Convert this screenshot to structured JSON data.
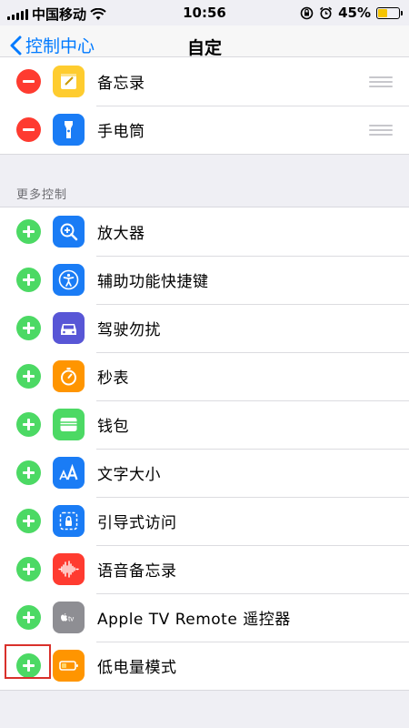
{
  "status_bar": {
    "carrier": "中国移动",
    "time": "10:56",
    "battery_percent": "45%",
    "battery_level": 0.45
  },
  "nav": {
    "back_label": "控制中心",
    "title": "自定"
  },
  "included_controls": [
    {
      "label": "备忘录",
      "icon": "notes-icon"
    },
    {
      "label": "手电筒",
      "icon": "flashlight-icon"
    }
  ],
  "more_controls_header": "更多控制",
  "more_controls": [
    {
      "label": "放大器",
      "icon": "magnifier-icon"
    },
    {
      "label": "辅助功能快捷键",
      "icon": "accessibility-icon"
    },
    {
      "label": "驾驶勿扰",
      "icon": "car-icon"
    },
    {
      "label": "秒表",
      "icon": "stopwatch-icon"
    },
    {
      "label": "钱包",
      "icon": "wallet-icon"
    },
    {
      "label": "文字大小",
      "icon": "text-size-icon"
    },
    {
      "label": "引导式访问",
      "icon": "guided-access-icon"
    },
    {
      "label": "语音备忘录",
      "icon": "voice-memo-icon"
    },
    {
      "label": "Apple TV Remote 遥控器",
      "icon": "apple-tv-remote-icon",
      "icon_text": "tv"
    },
    {
      "label": "低电量模式",
      "icon": "low-power-mode-icon"
    }
  ],
  "colors": {
    "remove": "#fe3b30",
    "add": "#4cd964",
    "accent": "#007aff",
    "highlight": "#d9302b"
  }
}
